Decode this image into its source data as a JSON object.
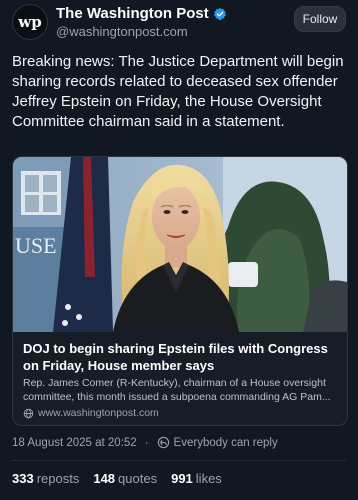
{
  "account": {
    "name": "The Washington Post",
    "handle": "@washingtonpost.com",
    "avatar_text": "wp",
    "follow_label": "Follow",
    "verified_icon": "verified-badge-icon",
    "verified_color": "#1d9bf0"
  },
  "post": {
    "text": "Breaking news: The Justice Department will begin sharing records related to deceased sex offender Jeffrey Epstein on Friday, the House Oversight Committee chairman said in a statement."
  },
  "link_card": {
    "image_icon": "news-photo",
    "title": "DOJ to begin sharing Epstein files with Congress on Friday, House  member says",
    "description": "Rep. James Comer (R-Kentucky), chairman of a House oversight committee, this month issued a subpoena commanding AG Pam...",
    "url": "www.washingtonpost.com",
    "link_icon": "globe-icon"
  },
  "meta": {
    "timestamp": "18 August 2025 at 20:52",
    "separator": "·",
    "reply_setting": "Everybody can reply",
    "reply_icon": "reply-setting-icon"
  },
  "stats": {
    "reposts_count": "333",
    "reposts_label": "reposts",
    "quotes_count": "148",
    "quotes_label": "quotes",
    "likes_count": "991",
    "likes_label": "likes"
  },
  "colors": {
    "background": "#121821",
    "follow_button_bg": "#2a313b",
    "muted_text": "#9aa4b1"
  }
}
